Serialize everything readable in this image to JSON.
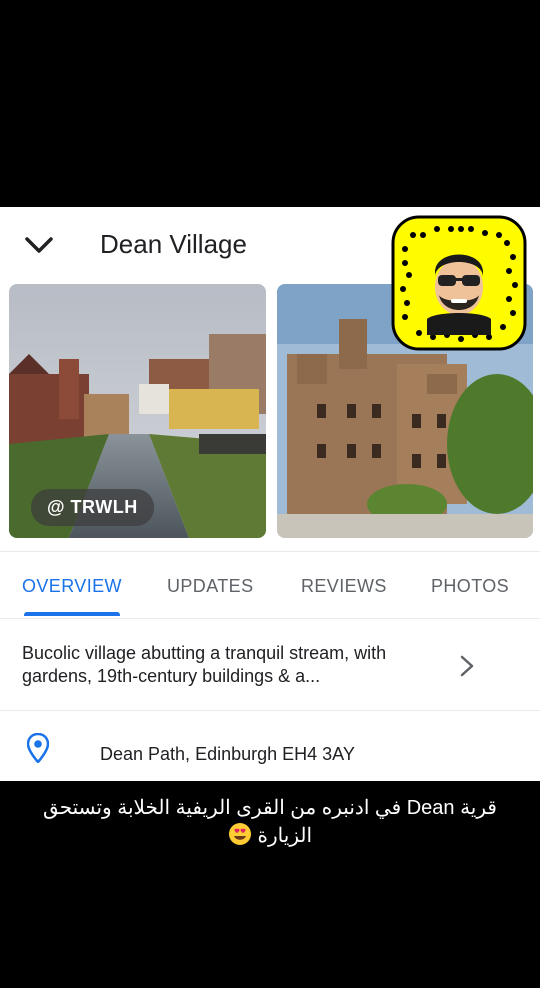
{
  "header": {
    "title": "Dean Village"
  },
  "photo_tag": "@ TRWLH",
  "tabs": [
    {
      "label": "OVERVIEW",
      "active": true
    },
    {
      "label": "UPDATES",
      "active": false
    },
    {
      "label": "REVIEWS",
      "active": false
    },
    {
      "label": "PHOTOS",
      "active": false
    }
  ],
  "description": "Bucolic village abutting a tranquil stream, with gardens, 19th-century buildings & a...",
  "address": "Dean Path, Edinburgh EH4 3AY",
  "caption": "قرية Dean في ادنبره من القرى الريفية الخلابة وتستحق الزيارة",
  "colors": {
    "accent": "#1a73e8",
    "snap_yellow": "#FFFC00"
  }
}
